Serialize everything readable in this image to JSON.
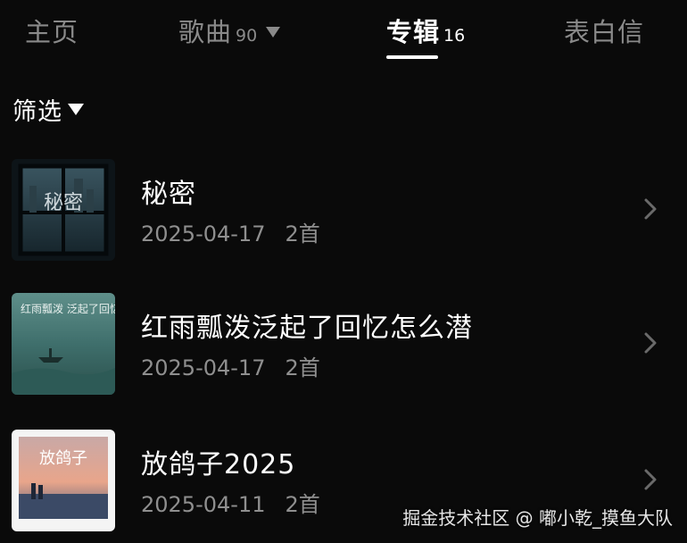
{
  "tabs": [
    {
      "label": "主页",
      "count": "",
      "active": false
    },
    {
      "label": "歌曲",
      "count": "90",
      "active": false,
      "dropdown": true
    },
    {
      "label": "专辑",
      "count": "16",
      "active": true
    },
    {
      "label": "表白信",
      "count": "",
      "active": false
    }
  ],
  "filter": {
    "label": "筛选",
    "icon": "caret-down-icon"
  },
  "albums": [
    {
      "title": "秘密",
      "date": "2025-04-17",
      "count": "2首",
      "cover_text": "秘密"
    },
    {
      "title": "红雨瓢泼泛起了回忆怎么潜",
      "date": "2025-04-17",
      "count": "2首",
      "cover_text": "红雨瓢泼 泛起了回忆 怎么潜"
    },
    {
      "title": "放鸽子2025",
      "date": "2025-04-11",
      "count": "2首",
      "cover_text": "放鸽子"
    }
  ],
  "watermark": "掘金技术社区 @ 嘟小乾_摸鱼大队",
  "colors": {
    "background": "#0a0a0a",
    "text_primary": "#ffffff",
    "text_secondary": "#8a8a8a"
  }
}
